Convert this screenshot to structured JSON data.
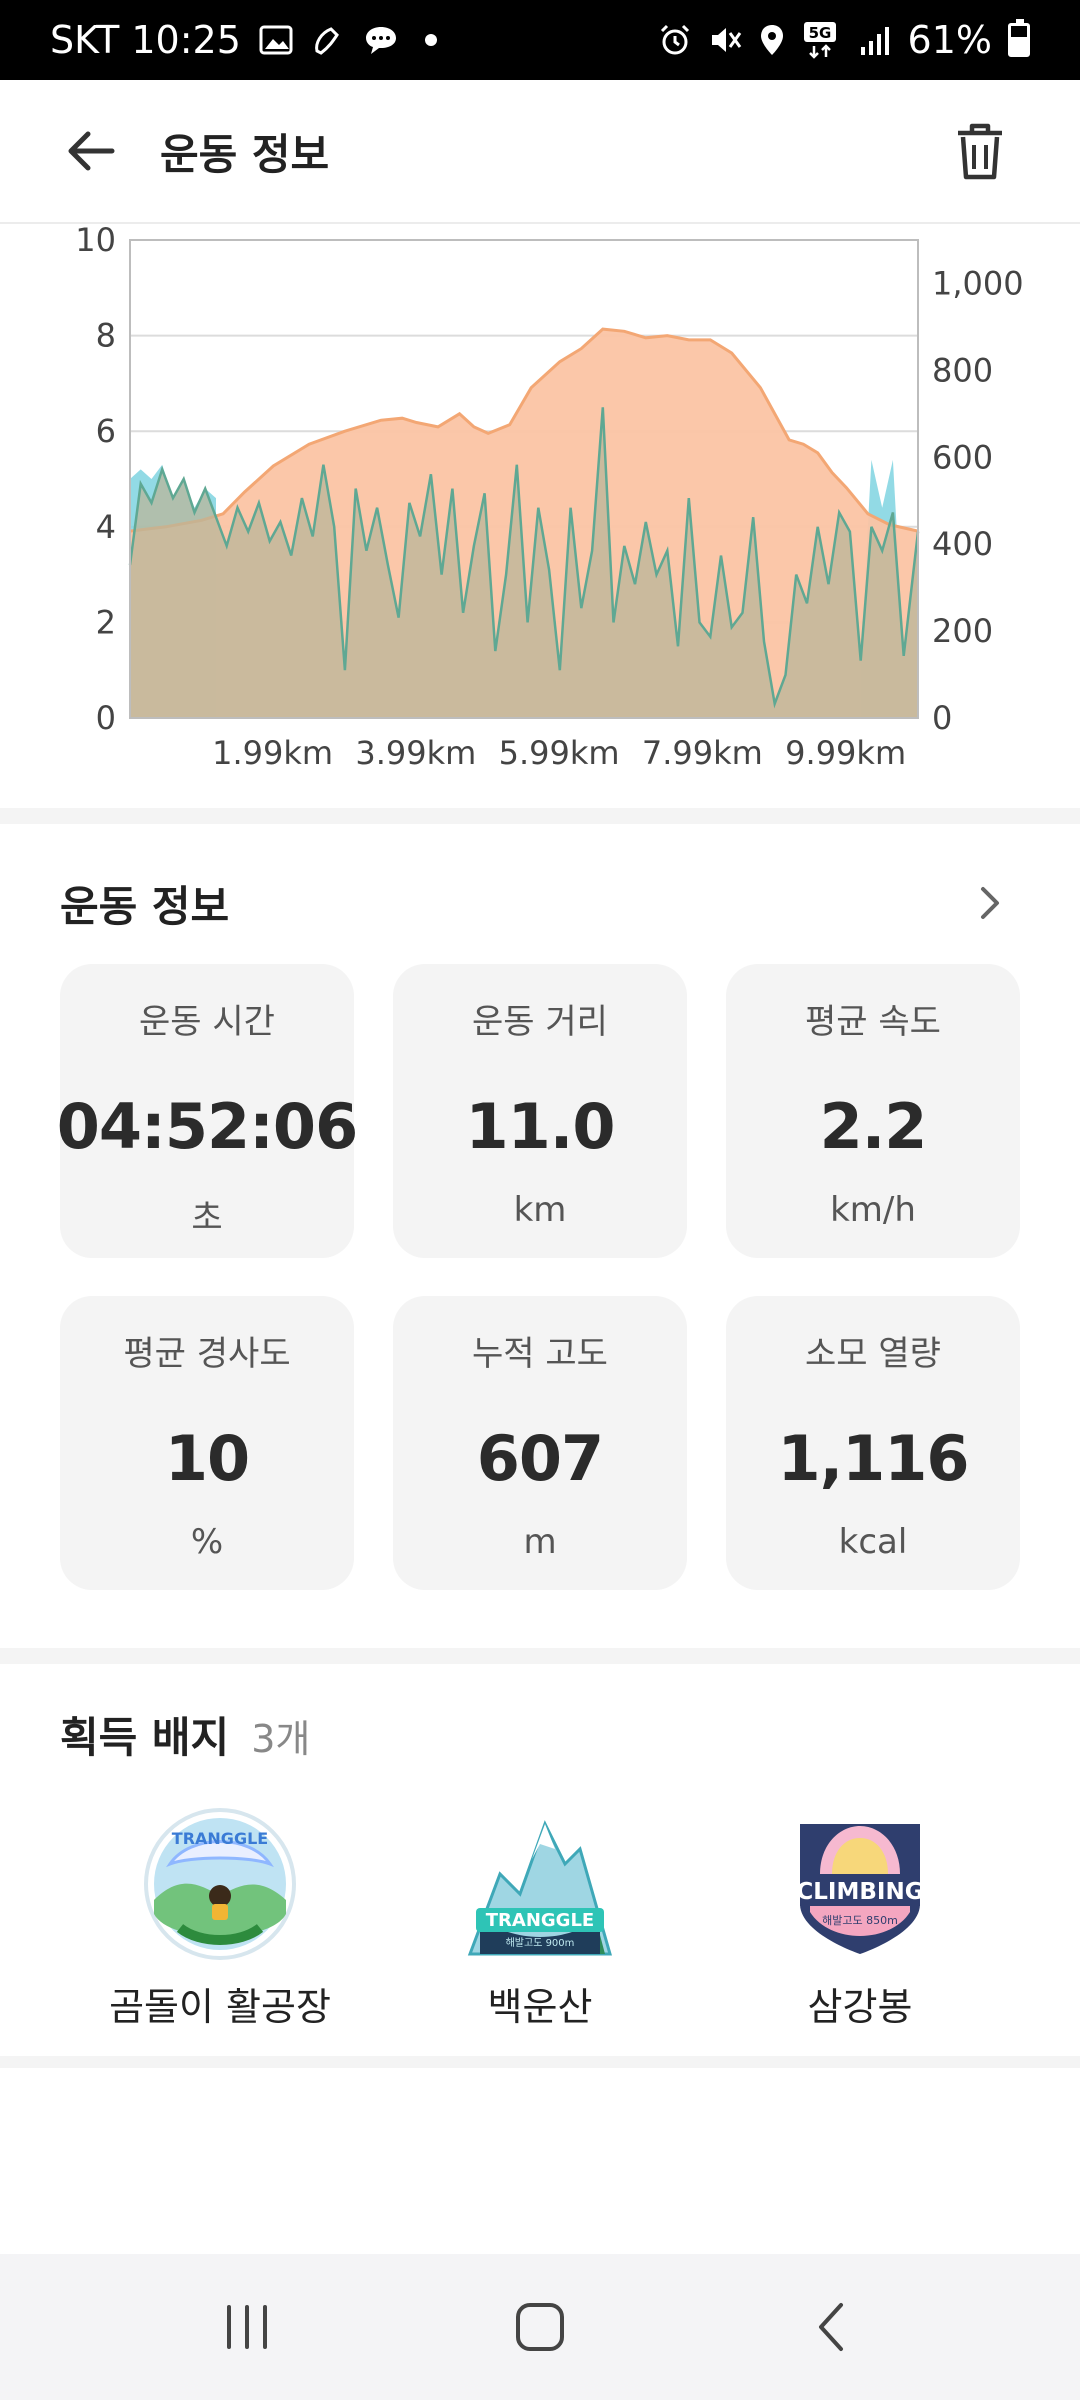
{
  "status_bar": {
    "carrier_time": "SKT 10:25",
    "signal": "5G",
    "battery": "61%",
    "battery_level": 0.61
  },
  "app_bar": {
    "title": "운동 정보",
    "back_icon": "arrow-left-icon",
    "delete_icon": "trash-icon"
  },
  "chart_data": {
    "type": "area",
    "x_ticks": [
      "1.99km",
      "3.99km",
      "5.99km",
      "7.99km",
      "9.99km"
    ],
    "x_range_km": [
      0,
      11.0
    ],
    "left_axis": {
      "ticks": [
        "0",
        "2",
        "4",
        "6",
        "8",
        "10"
      ],
      "range": [
        0,
        10
      ]
    },
    "right_axis": {
      "ticks": [
        "0",
        "200",
        "400",
        "600",
        "800",
        "1,000"
      ],
      "range": [
        0,
        1100
      ]
    },
    "grid": true,
    "series": [
      {
        "axis": "right",
        "color": "#f3a774",
        "fill": "#fbc4a4",
        "x": [
          0,
          0.5,
          1.0,
          1.3,
          1.6,
          2.0,
          2.5,
          3.0,
          3.5,
          3.8,
          4.0,
          4.3,
          4.6,
          4.8,
          5.0,
          5.3,
          5.6,
          6.0,
          6.3,
          6.6,
          6.9,
          7.2,
          7.5,
          7.8,
          8.1,
          8.4,
          8.8,
          9.2,
          9.4,
          9.6,
          9.8,
          10.0,
          10.3,
          10.6,
          11.0
        ],
        "values": [
          430,
          440,
          455,
          470,
          520,
          580,
          630,
          660,
          685,
          690,
          680,
          670,
          700,
          670,
          655,
          675,
          760,
          820,
          850,
          895,
          890,
          875,
          880,
          870,
          870,
          840,
          760,
          640,
          630,
          610,
          565,
          530,
          470,
          445,
          430
        ]
      },
      {
        "axis": "left",
        "color": "#5fa893",
        "fill": "#b9b69a",
        "x": [
          0,
          0.15,
          0.3,
          0.45,
          0.6,
          0.75,
          0.9,
          1.05,
          1.2,
          1.35,
          1.5,
          1.65,
          1.8,
          1.95,
          2.1,
          2.25,
          2.4,
          2.55,
          2.7,
          2.85,
          3.0,
          3.15,
          3.3,
          3.45,
          3.6,
          3.75,
          3.9,
          4.05,
          4.2,
          4.35,
          4.5,
          4.65,
          4.8,
          4.95,
          5.1,
          5.25,
          5.4,
          5.55,
          5.7,
          5.85,
          6.0,
          6.15,
          6.3,
          6.45,
          6.6,
          6.75,
          6.9,
          7.05,
          7.2,
          7.35,
          7.5,
          7.65,
          7.8,
          7.95,
          8.1,
          8.25,
          8.4,
          8.55,
          8.7,
          8.85,
          9.0,
          9.15,
          9.3,
          9.45,
          9.6,
          9.75,
          9.9,
          10.05,
          10.2,
          10.35,
          10.5,
          10.65,
          10.8,
          11.0
        ],
        "values": [
          3.2,
          4.9,
          4.5,
          5.2,
          4.6,
          5.0,
          4.3,
          4.8,
          4.2,
          3.6,
          4.4,
          3.9,
          4.5,
          3.7,
          4.1,
          3.4,
          4.6,
          3.8,
          5.3,
          4.0,
          1.0,
          4.8,
          3.5,
          4.4,
          3.2,
          2.1,
          4.5,
          3.8,
          5.1,
          3.0,
          4.8,
          2.2,
          3.6,
          4.7,
          1.4,
          3.0,
          5.3,
          2.0,
          4.4,
          3.1,
          1.0,
          4.4,
          2.3,
          3.5,
          6.5,
          2.0,
          3.6,
          2.8,
          4.1,
          3.0,
          3.5,
          1.5,
          4.6,
          2.0,
          1.7,
          3.4,
          1.9,
          2.2,
          4.2,
          1.6,
          0.3,
          0.9,
          3.0,
          2.4,
          4.0,
          2.8,
          4.3,
          3.9,
          1.2,
          4.0,
          3.5,
          4.3,
          1.3,
          3.9
        ],
        "overlay_color": "#7fd4e0",
        "overlay_x": [
          0,
          0.15,
          0.3,
          0.45,
          0.6,
          0.75,
          0.9,
          1.05,
          1.2,
          10.2,
          10.35,
          10.5,
          10.65,
          10.8,
          11.0
        ],
        "overlay_values": [
          5.0,
          5.2,
          5.0,
          5.3,
          4.6,
          5.0,
          4.4,
          4.8,
          4.6,
          1.2,
          5.4,
          4.4,
          5.4,
          1.3,
          4.0
        ]
      }
    ]
  },
  "workout_info": {
    "title": "운동 정보",
    "stats": [
      {
        "label": "운동 시간",
        "value": "04:52:06",
        "unit": "초"
      },
      {
        "label": "운동 거리",
        "value": "11.0",
        "unit": "km"
      },
      {
        "label": "평균 속도",
        "value": "2.2",
        "unit": "km/h"
      },
      {
        "label": "평균 경사도",
        "value": "10",
        "unit": "%"
      },
      {
        "label": "누적 고도",
        "value": "607",
        "unit": "m"
      },
      {
        "label": "소모 열량",
        "value": "1,116",
        "unit": "kcal"
      }
    ]
  },
  "badges": {
    "title": "획득 배지",
    "count": "3개",
    "items": [
      {
        "name": "곰돌이 활공장",
        "icon": "bear-paraglide-badge-icon",
        "badge_text": "TRANGGLE"
      },
      {
        "name": "백운산",
        "icon": "mountain-badge-icon",
        "badge_text": "TRANGGLE",
        "badge_sub": "해발고도 900m"
      },
      {
        "name": "삼강봉",
        "icon": "climbing-badge-icon",
        "badge_text": "CLIMBING",
        "badge_sub": "해발고도 850m"
      }
    ]
  }
}
